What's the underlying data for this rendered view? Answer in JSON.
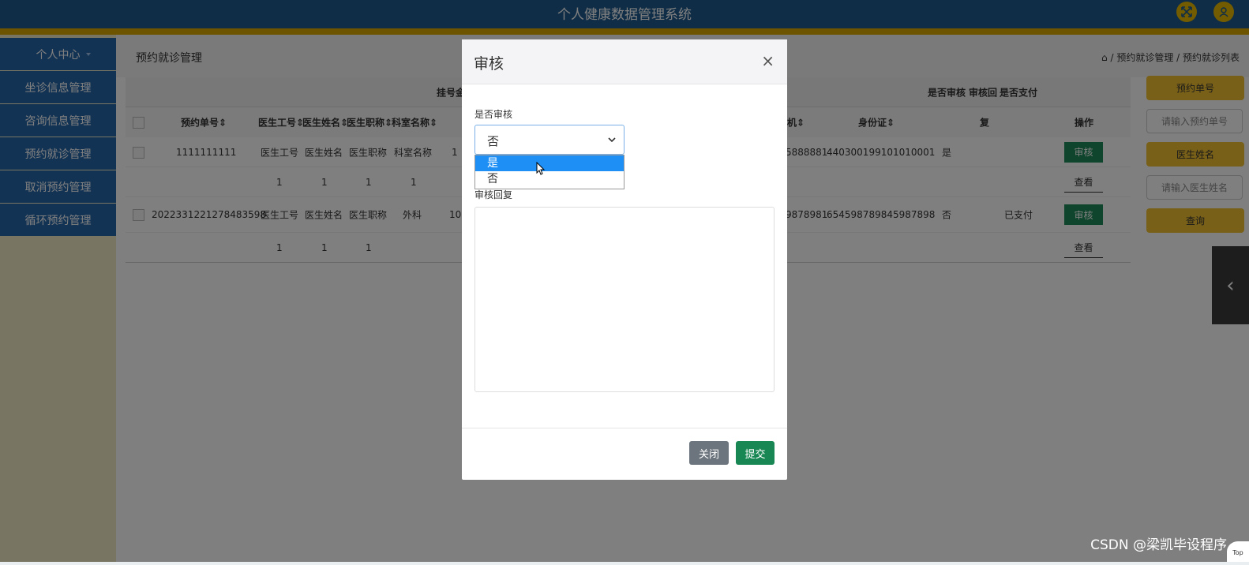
{
  "header": {
    "title": "个人健康数据管理系统"
  },
  "sidebar": {
    "items": [
      {
        "label": "个人中心"
      },
      {
        "label": "坐诊信息管理"
      },
      {
        "label": "咨询信息管理"
      },
      {
        "label": "预约就诊管理"
      },
      {
        "label": "取消预约管理"
      },
      {
        "label": "循环预约管理"
      }
    ]
  },
  "page": {
    "title": "预约就诊管理",
    "breadcrumb": "/ 预约就诊管理 / 预约就诊列表"
  },
  "table": {
    "group_headers": {
      "fee": "挂号金",
      "audit": "是否审核",
      "reply": "审核回",
      "paid": "是否支付"
    },
    "columns": [
      "预约单号",
      "医生工号",
      "医生姓名",
      "医生职称",
      "科室名称",
      "机",
      "身份证",
      "复",
      "操作"
    ],
    "rows": [
      {
        "id": "1111111111",
        "doc_id": "医生工号",
        "doc_name": "医生姓名",
        "doc_title": "医生职称",
        "dept": "科室名称",
        "fee": "1",
        "phone": "5888881",
        "idcard": "440300199101010001",
        "audited": "是",
        "paid": "",
        "sub": [
          "1",
          "1",
          "1",
          "1"
        ]
      },
      {
        "id": "2022331221278483598",
        "doc_id": "医生工号",
        "doc_name": "医生姓名",
        "doc_title": "医生职称",
        "dept": "外科",
        "fee": "10",
        "phone": "9878981",
        "idcard": "654598789845987898",
        "audited": "否",
        "paid": "已支付",
        "sub": [
          "1",
          "1",
          "1"
        ]
      }
    ],
    "approve_label": "审核",
    "view_label": "查看"
  },
  "search": {
    "btn_order": "预约单号",
    "ph_order": "请输入预约单号",
    "btn_doctor": "医生姓名",
    "ph_doctor": "请输入医生姓名",
    "btn_query": "查询"
  },
  "modal": {
    "title": "审核",
    "audit_label": "是否审核",
    "audit_value": "否",
    "options": [
      "是",
      "否"
    ],
    "reply_label": "审核回复",
    "close_btn": "关闭",
    "submit_btn": "提交"
  },
  "watermark": "CSDN @梁凯毕设程序",
  "top_label": "Top"
}
